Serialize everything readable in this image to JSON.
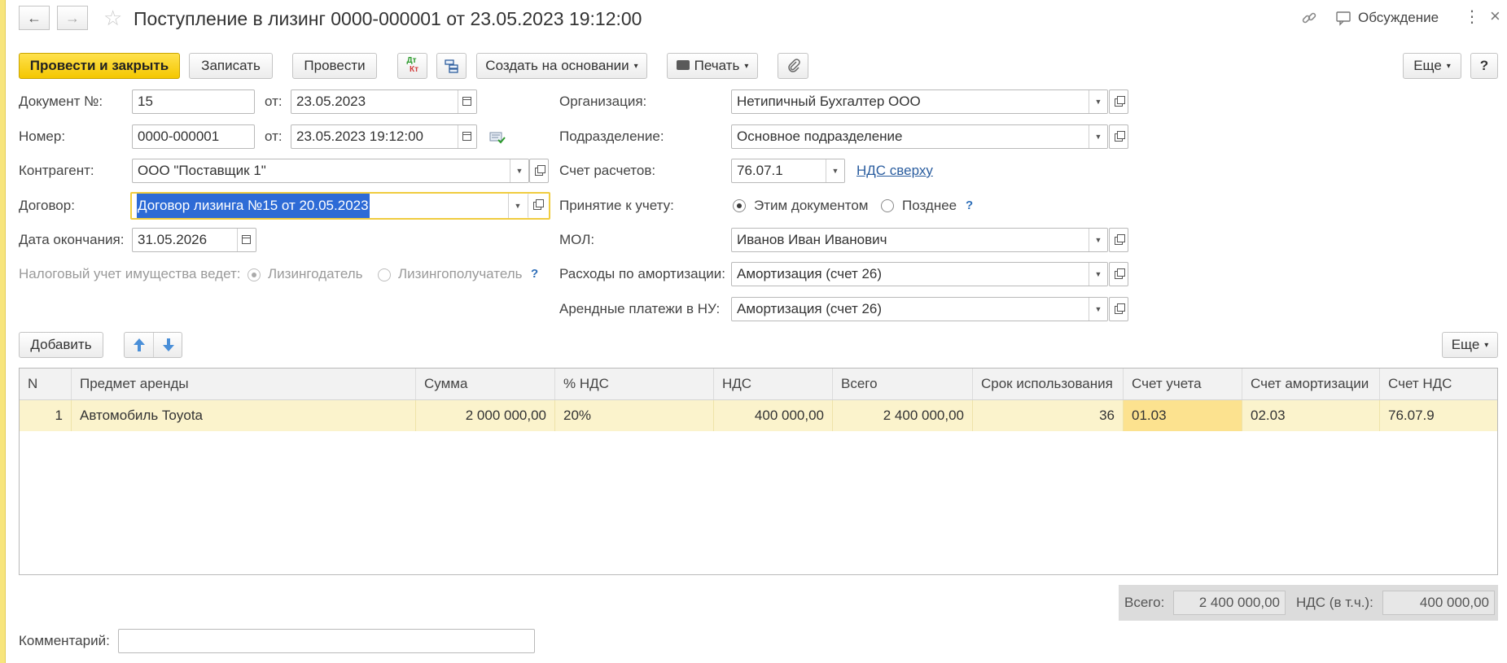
{
  "window": {
    "title": "Поступление в лизинг 0000-000001 от 23.05.2023 19:12:00",
    "discussion_label": "Обсуждение"
  },
  "toolbar": {
    "post_close": "Провести и закрыть",
    "save": "Записать",
    "post": "Провести",
    "dtkt_dt": "Дт",
    "dtkt_kt": "Кт",
    "create_based": "Создать на основании",
    "print": "Печать",
    "more": "Еще",
    "help": "?"
  },
  "form": {
    "doc_no_label": "Документ №:",
    "doc_no_value": "15",
    "from_label": "от:",
    "doc_date": "23.05.2023",
    "number_label": "Номер:",
    "number_value": "0000-000001",
    "number_datetime": "23.05.2023 19:12:00",
    "counterparty_label": "Контрагент:",
    "counterparty_value": "ООО \"Поставщик 1\"",
    "contract_label": "Договор:",
    "contract_value": "Договор лизинга №15 от 20.05.2023",
    "end_date_label": "Дата окончания:",
    "end_date_value": "31.05.2026",
    "tax_label": "Налоговый учет имущества ведет:",
    "tax_opt1": "Лизингодатель",
    "tax_opt2": "Лизингополучатель",
    "org_label": "Организация:",
    "org_value": "Нетипичный Бухгалтер ООО",
    "dept_label": "Подразделение:",
    "dept_value": "Основное подразделение",
    "account_label": "Счет расчетов:",
    "account_value": "76.07.1",
    "vat_link": "НДС сверху",
    "accept_label": "Принятие к учету:",
    "accept_opt1": "Этим документом",
    "accept_opt2": "Позднее",
    "mol_label": "МОЛ:",
    "mol_value": "Иванов Иван Иванович",
    "amort_label": "Расходы по амортизации:",
    "amort_value": "Амортизация (счет 26)",
    "lease_label": "Арендные платежи в НУ:",
    "lease_value": "Амортизация (счет 26)",
    "question": "?"
  },
  "table_toolbar": {
    "add": "Добавить",
    "more": "Еще"
  },
  "table": {
    "headers": [
      "N",
      "Предмет аренды",
      "Сумма",
      "% НДС",
      "НДС",
      "Всего",
      "Срок использования",
      "Счет учета",
      "Счет амортизации",
      "Счет НДС"
    ],
    "rows": [
      [
        "1",
        "Автомобиль Toyota",
        "2 000 000,00",
        "20%",
        "400 000,00",
        "2 400 000,00",
        "36",
        "01.03",
        "02.03",
        "76.07.9"
      ]
    ]
  },
  "totals": {
    "total_label": "Всего:",
    "total_value": "2 400 000,00",
    "vat_label": "НДС (в т.ч.):",
    "vat_value": "400 000,00"
  },
  "comment": {
    "label": "Комментарий:",
    "value": ""
  },
  "colors": {
    "primary_button": "#f4c700",
    "focus_border": "#f0cc3f",
    "selected_row": "#fbf3cc",
    "link": "#2a5d9f"
  }
}
